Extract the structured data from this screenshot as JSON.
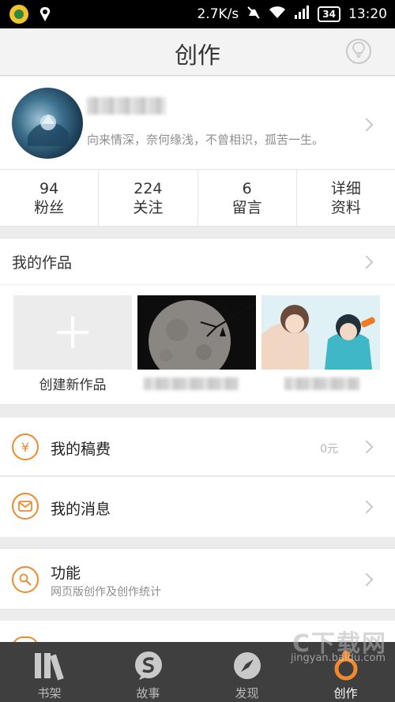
{
  "status_bar": {
    "net_speed": "2.7K/s",
    "battery": "34",
    "time": "13:20"
  },
  "header": {
    "title": "创作"
  },
  "profile": {
    "signature": "向来情深，奈何缘浅，不曾相识，孤苦一生。"
  },
  "stats": [
    {
      "value": "94",
      "label": "粉丝"
    },
    {
      "value": "224",
      "label": "关注"
    },
    {
      "value": "6",
      "label": "留言"
    },
    {
      "value": "详细",
      "label": "资料"
    }
  ],
  "works": {
    "title": "我的作品",
    "new_label": "创建新作品"
  },
  "rows": {
    "royalty": {
      "label": "我的稿费",
      "value": "0元",
      "icon": "¥"
    },
    "messages": {
      "label": "我的消息"
    },
    "features": {
      "label": "功能",
      "sub": "网页版创作及创作统计"
    }
  },
  "nav": [
    {
      "label": "书架"
    },
    {
      "label": "故事"
    },
    {
      "label": "发现"
    },
    {
      "label": "创作"
    }
  ],
  "watermark": {
    "main": "C下载网",
    "sub": "jingyan.baidu.com"
  },
  "colors": {
    "accent": "#f08a2c",
    "nav_bg": "#3f3f3f",
    "page_bg": "#ececec"
  }
}
